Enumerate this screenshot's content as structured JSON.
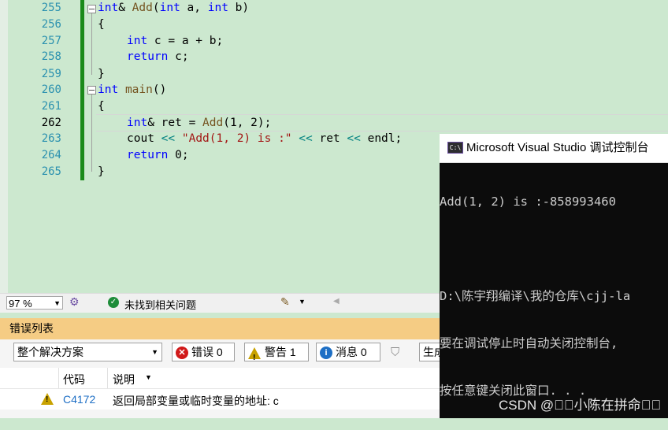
{
  "editor": {
    "line_numbers": [
      "255",
      "256",
      "257",
      "258",
      "259",
      "260",
      "261",
      "262",
      "263",
      "264",
      "265"
    ],
    "lines": {
      "l255": {
        "kw1": "int",
        "amp": "& ",
        "fn": "Add",
        "p1": "(",
        "kw2": "int",
        "a": " a, ",
        "kw3": "int",
        "b": " b)"
      },
      "l256": "{",
      "l257": {
        "kw": "int",
        "rest": " c = a + b;"
      },
      "l258": {
        "kw": "return",
        "rest": " c;"
      },
      "l259": "}",
      "l260": {
        "kw": "int",
        "sp": " ",
        "fn": "main",
        "rest": "()"
      },
      "l261": "{",
      "l262": {
        "kw": "int",
        "mid": "& ret = ",
        "fn": "Add",
        "rest": "(1, 2);"
      },
      "l263": {
        "a": "cout ",
        "op1": "<<",
        "str": " \"Add(1, 2) is :\" ",
        "op2": "<<",
        "b": " ret ",
        "op3": "<<",
        "c": " endl;"
      },
      "l264": {
        "kw": "return",
        "rest": " 0;"
      },
      "l265": "}"
    }
  },
  "status": {
    "zoom": "97 %",
    "issues": "未找到相关问题"
  },
  "error_list": {
    "title": "错误列表",
    "scope": "整个解决方案",
    "errors": "错误 0",
    "warnings": "警告 1",
    "messages": "消息 0",
    "build_label": "生成",
    "col_code": "代码",
    "col_desc": "说明",
    "rows": [
      {
        "code": "C4172",
        "desc": "返回局部变量或临时变量的地址: c"
      }
    ]
  },
  "console": {
    "title": "Microsoft Visual Studio 调试控制台",
    "icon_label": "C:\\",
    "lines": [
      "Add(1, 2) is :-858993460",
      "",
      "D:\\陈宇翔编译\\我的仓库\\cjj-la",
      "要在调试停止时自动关闭控制台,",
      "按任意键关闭此窗口. . ."
    ]
  },
  "watermark": "CSDN @\u0000\u0000小陈在拼命\u0000\u0000",
  "colors": {
    "editor_bg": "#cce8cf",
    "keyword": "#0000ff",
    "string": "#a31515",
    "operator": "#008080",
    "line_number": "#2b91af",
    "change_bar": "#1a8a1a",
    "error_list_title_bg": "#f5cc84"
  }
}
